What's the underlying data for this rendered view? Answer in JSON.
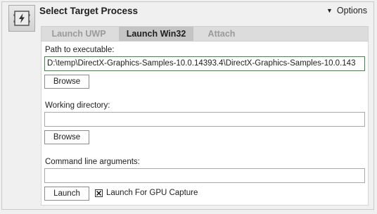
{
  "header": {
    "title": "Select Target Process",
    "options_label": "Options",
    "app_icon": "lightning-icon"
  },
  "tabs": [
    {
      "label": "Launch UWP",
      "active": false
    },
    {
      "label": "Launch Win32",
      "active": true
    },
    {
      "label": "Attach",
      "active": false
    }
  ],
  "form": {
    "path_label": "Path to executable:",
    "path_value": "D:\\temp\\DirectX-Graphics-Samples-10.0.14393.4\\DirectX-Graphics-Samples-10.0.143",
    "browse_label_1": "Browse",
    "workdir_label": "Working directory:",
    "workdir_value": "",
    "browse_label_2": "Browse",
    "args_label": "Command line arguments:",
    "args_value": "",
    "launch_label": "Launch",
    "gpu_capture_label": "Launch For GPU Capture",
    "gpu_capture_checked": true
  },
  "colors": {
    "focused_border": "#3c8a48",
    "active_tab": "#c4c4c4"
  }
}
